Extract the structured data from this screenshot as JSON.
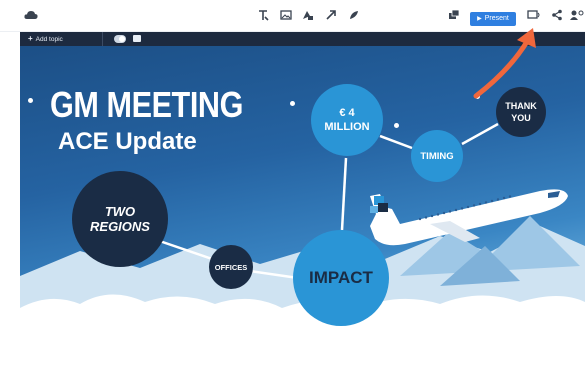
{
  "toolbar": {
    "present_label": "Present",
    "icons": [
      "cloud-menu-icon",
      "text-icon",
      "image-icon",
      "shape-icon",
      "arrow-icon",
      "style-icon",
      "layers-icon",
      "play-icon",
      "present-remote-icon",
      "share-icon",
      "collaborators-icon"
    ]
  },
  "subbar": {
    "add_topic_label": "Add topic"
  },
  "canvas": {
    "title": "GM MEETING",
    "subtitle": "ACE Update",
    "topics": {
      "two_regions": "TWO\nREGIONS",
      "offices": "OFFICES",
      "million": "€ 4\nMILLION",
      "timing": "TIMING",
      "thank_you": "THANK\nYOU",
      "impact": "IMPACT"
    }
  },
  "colors": {
    "accent": "#2f7fe0",
    "annotation_arrow": "#f0673c",
    "dark_bubble": "#1a2c45",
    "light_bubble": "#2a95d6"
  }
}
